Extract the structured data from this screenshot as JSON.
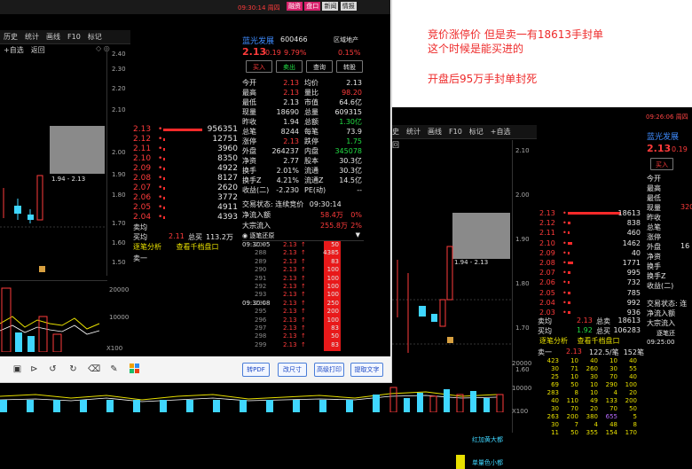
{
  "annotations": {
    "line1": "竞价涨停价 但是卖一有18613手封单",
    "line2": "这个时候是能买进的",
    "line3": "开盘后95万手封单封死"
  },
  "front": {
    "toolbar": [
      "历史",
      "统计",
      "画线",
      "F10",
      "标记",
      "+自选",
      "返回"
    ],
    "title_time": "09:30:14 周四",
    "tabs": [
      "融资",
      "盘口",
      "新闻",
      "情报"
    ],
    "stock": {
      "name": "蓝光发展",
      "code": "600466",
      "sector": "区域地产",
      "price": "2.13",
      "change": "0.19",
      "pct": "9.79%",
      "sector_pct": "0.15%"
    },
    "trade_buttons": [
      "买入",
      "卖出",
      "查询",
      "转股"
    ],
    "stats": [
      [
        "今开",
        "2.13",
        "均价",
        "2.13"
      ],
      [
        "最高",
        "2.13",
        "量比",
        "98.20"
      ],
      [
        "最低",
        "2.13",
        "市值",
        "64.6亿"
      ],
      [
        "现量",
        "18690",
        "总量",
        "609315"
      ],
      [
        "昨收",
        "1.94",
        "总额",
        "1.30亿"
      ],
      [
        "总笔",
        "8244",
        "每笔",
        "73.9"
      ],
      [
        "涨停",
        "2.13",
        "跌停",
        "1.75"
      ],
      [
        "外盘",
        "264237",
        "内盘",
        "345078"
      ],
      [
        "净资",
        "2.77",
        "股本",
        "30.3亿"
      ],
      [
        "换手",
        "2.01%",
        "流通",
        "30.3亿"
      ],
      [
        "换手Z",
        "4.21%",
        "流通Z",
        "14.5亿"
      ],
      [
        "收益(二)",
        "-2.230",
        "PE(动)",
        "--"
      ]
    ],
    "auction": {
      "label": "交易状态:",
      "value": "连续竞价",
      "time": "09:30:14"
    },
    "flows": [
      {
        "label": "净流入额",
        "value": "58.4万",
        "pct": "0%"
      },
      {
        "label": "大宗流入",
        "value": "255.8万",
        "pct": "2%"
      }
    ],
    "ticks_header": "逐笔还原",
    "order_book": [
      {
        "price": "2.13",
        "vol": "956351"
      },
      {
        "price": "2.12",
        "vol": "12751"
      },
      {
        "price": "2.11",
        "vol": "3960"
      },
      {
        "price": "2.10",
        "vol": "8350"
      },
      {
        "price": "2.09",
        "vol": "4922"
      },
      {
        "price": "2.08",
        "vol": "8127"
      },
      {
        "price": "2.07",
        "vol": "2620"
      },
      {
        "price": "2.06",
        "vol": "3772"
      },
      {
        "price": "2.05",
        "vol": "4911"
      },
      {
        "price": "2.04",
        "vol": "4393"
      }
    ],
    "weibi": "卖均",
    "buysell": {
      "label": "买均",
      "mid": "2.11",
      "total_label": "总买",
      "total": "113.2万"
    },
    "links": [
      "逐笔分析",
      "查看千档盘口"
    ],
    "sell1_label": "卖一",
    "fills": [
      {
        "t": "09:30:05",
        "n": "209",
        "p": "2.13",
        "v": "50"
      },
      {
        "t": "",
        "n": "288",
        "p": "2.13",
        "v": "4385"
      },
      {
        "t": "",
        "n": "289",
        "p": "2.13",
        "v": "83"
      },
      {
        "t": "",
        "n": "290",
        "p": "2.13",
        "v": "100"
      },
      {
        "t": "",
        "n": "291",
        "p": "2.13",
        "v": "100"
      },
      {
        "t": "",
        "n": "292",
        "p": "2.13",
        "v": "100"
      },
      {
        "t": "",
        "n": "293",
        "p": "2.13",
        "v": "100"
      },
      {
        "t": "09:30:08",
        "n": "294",
        "p": "2.13",
        "v": "250"
      },
      {
        "t": "",
        "n": "295",
        "p": "2.13",
        "v": "200"
      },
      {
        "t": "",
        "n": "296",
        "p": "2.13",
        "v": "100"
      },
      {
        "t": "",
        "n": "297",
        "p": "2.13",
        "v": "83"
      },
      {
        "t": "",
        "n": "298",
        "p": "2.13",
        "v": "50"
      },
      {
        "t": "",
        "n": "299",
        "p": "2.13",
        "v": "83"
      }
    ],
    "price_axis": [
      "2.40",
      "2.30",
      "2.20",
      "2.10",
      "2.00",
      "1.90",
      "1.80",
      "1.70",
      "1.60",
      "1.50"
    ],
    "vol_axis": [
      "20000",
      "10000",
      "X100"
    ],
    "range_label": "1.94 - 2.13",
    "bottom_buttons": [
      "转PDF",
      "改尺寸",
      "高级打印",
      "提取文字"
    ]
  },
  "back": {
    "toolbar": [
      "历史",
      "统计",
      "画线",
      "F10",
      "标记",
      "+自选",
      "返回"
    ],
    "title_time": "09:26:06 周四",
    "stock": {
      "name": "蓝光发展",
      "price": "2.13",
      "change": "0.19"
    },
    "trade_buttons": [
      "买入"
    ],
    "stats_labels": [
      "今开",
      "最高",
      "最低",
      "现量",
      "昨收",
      "总笔",
      "涨停",
      "外盘",
      "净资",
      "换手",
      "换手Z",
      "收益(二)"
    ],
    "stats_value": "320",
    "stats_value2": "16",
    "auction": "交易状态: 连",
    "flows": [
      "净流入额",
      "大宗流入"
    ],
    "ticks_header": "逐笔还",
    "ticks_time": "09:25:00",
    "order_book": [
      {
        "price": "2.13",
        "vol": "18613"
      },
      {
        "price": "2.12",
        "vol": "838"
      },
      {
        "price": "2.11",
        "vol": "460"
      },
      {
        "price": "2.10",
        "vol": "1462"
      },
      {
        "price": "2.09",
        "vol": "40"
      },
      {
        "price": "2.08",
        "vol": "1771"
      },
      {
        "price": "2.07",
        "vol": "995"
      },
      {
        "price": "2.06",
        "vol": "732"
      },
      {
        "price": "2.05",
        "vol": "785"
      },
      {
        "price": "2.04",
        "vol": "992"
      },
      {
        "price": "2.03",
        "vol": "936"
      }
    ],
    "weibi": {
      "label": "卖均",
      "price": "2.13",
      "total_label": "总卖",
      "total": "18613"
    },
    "buy": {
      "label": "买均",
      "price": "1.92",
      "total_label": "总买",
      "total": "106283"
    },
    "links": [
      "逐笔分析",
      "查看千档盘口"
    ],
    "sell1": {
      "label": "卖一",
      "price": "2.13",
      "per": "122.5/笔",
      "count": "152笔"
    },
    "grid": [
      [
        "423",
        "10",
        "40",
        "10",
        "40"
      ],
      [
        "30",
        "71",
        "260",
        "30",
        "55"
      ],
      [
        "25",
        "10",
        "30",
        "70",
        "40"
      ],
      [
        "69",
        "50",
        "10",
        "290",
        "100"
      ],
      [
        "283",
        "8",
        "10",
        "4",
        "20"
      ],
      [
        "40",
        "110",
        "49",
        "133",
        "200"
      ],
      [
        "30",
        "70",
        "20",
        "70",
        "50"
      ],
      [
        "263",
        "200",
        "380",
        "655",
        "5"
      ],
      [
        "30",
        "7",
        "4",
        "48",
        "8"
      ],
      [
        "11",
        "50",
        "355",
        "154",
        "170"
      ]
    ],
    "price_axis": [
      "2.10",
      "2.00",
      "1.90",
      "1.80",
      "1.70",
      "1.60"
    ],
    "vol_axis": [
      "20000",
      "10000",
      "X100"
    ],
    "range_label": "1.94 - 2.13",
    "legend": [
      "红加黄大都",
      "单量色小都"
    ]
  },
  "colors": {
    "up": "#ff3b3b",
    "down": "#22dd44",
    "cyan": "#3fd6ff",
    "note": "#ee2a2a"
  }
}
